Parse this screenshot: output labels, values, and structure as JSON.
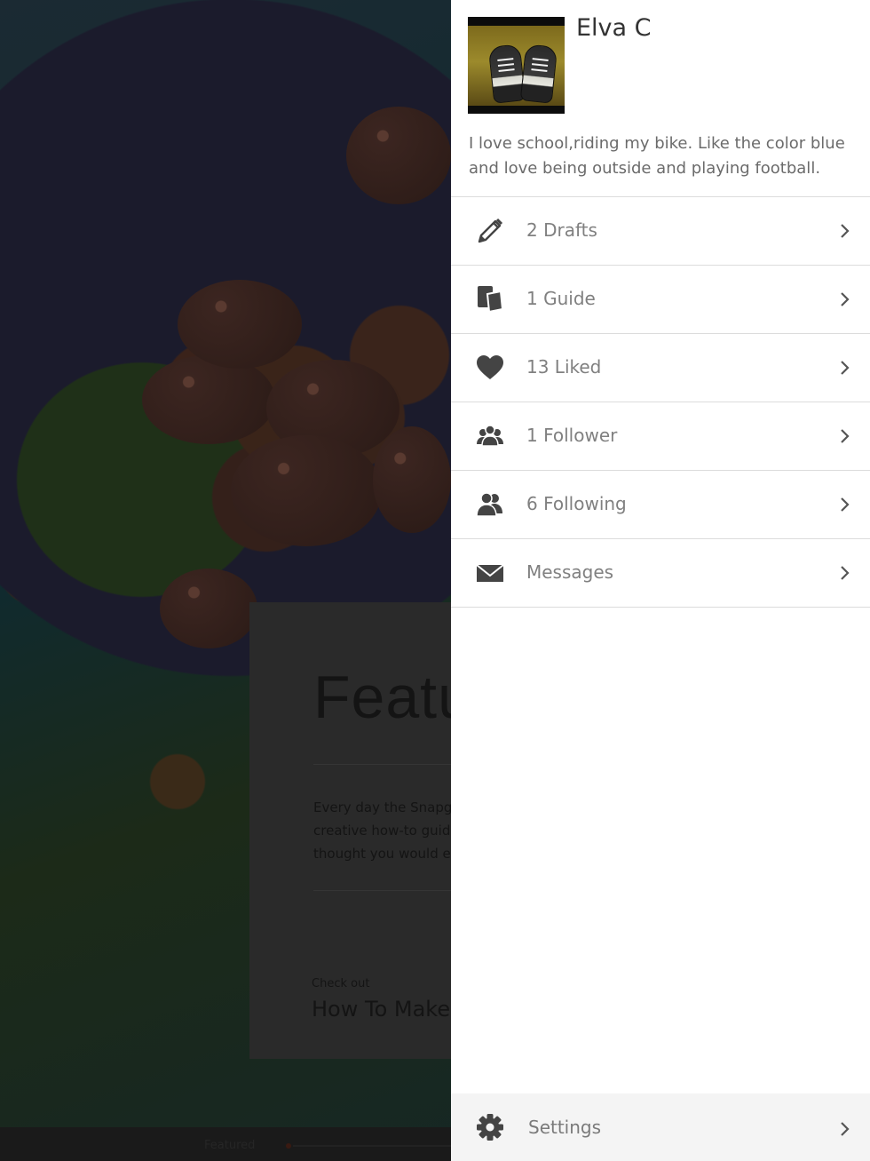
{
  "background": {
    "feature_title": "Featu",
    "feature_body": "Every day the Snapg\ncreative how-to guid\nthought you would e",
    "check_out_label": "Check out",
    "check_out_link": "How To Make I",
    "bottom_tab_label": "Featured"
  },
  "profile": {
    "name": "Elva C",
    "bio": "I love school,riding my bike. Like the color blue and love being outside and playing football.",
    "avatar_icon": "shoes-photo-avatar"
  },
  "menu": [
    {
      "label": "2 Drafts",
      "icon": "pencil-icon"
    },
    {
      "label": "1 Guide",
      "icon": "guide-cards-icon"
    },
    {
      "label": "13 Liked",
      "icon": "heart-icon"
    },
    {
      "label": "1 Follower",
      "icon": "followers-icon"
    },
    {
      "label": "6 Following",
      "icon": "following-icon"
    },
    {
      "label": "Messages",
      "icon": "envelope-icon"
    }
  ],
  "settings": {
    "label": "Settings",
    "icon": "gear-icon"
  },
  "colors": {
    "drawer_bg": "#ffffff",
    "divider": "#dcdcdc",
    "icon": "#444444",
    "label_text": "#808080",
    "settings_bg": "#f4f4f4"
  }
}
